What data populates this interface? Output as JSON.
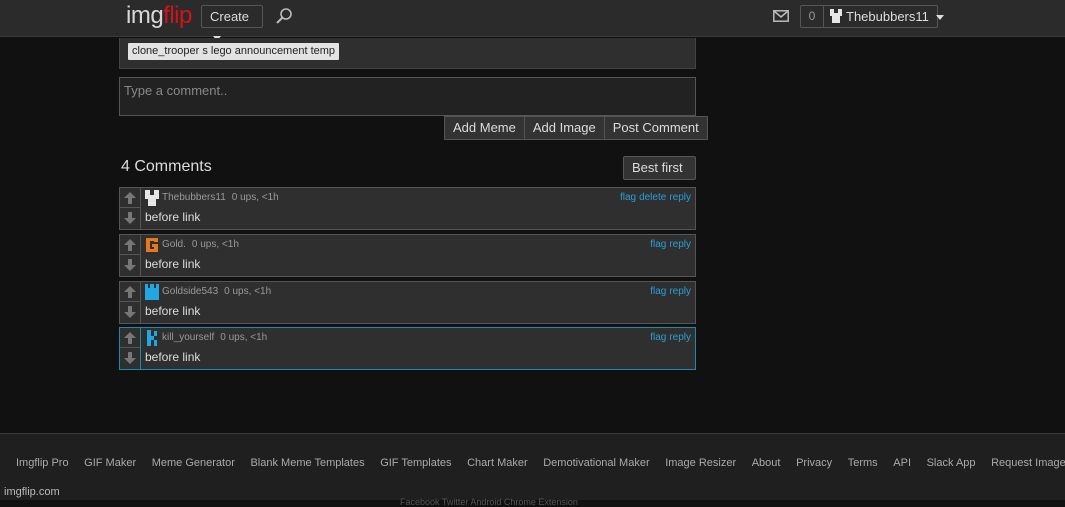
{
  "header": {
    "logo_part1": "img",
    "logo_part2": "flip",
    "create_label": "Create",
    "search_icon": "search-icon",
    "mail_icon": "mail-icon",
    "notification_count": "0",
    "username": "Thebubbers11"
  },
  "tag": {
    "label": "clone_trooper s lego announcement temp"
  },
  "comment_form": {
    "placeholder": "Type a comment..",
    "value": "",
    "buttons": [
      "Add Meme",
      "Add Image",
      "Post Comment"
    ]
  },
  "comments_section": {
    "title": "4 Comments",
    "sort_label": "Best first",
    "comments": [
      {
        "user": "Thebubbers11",
        "meta": "0 ups, <1h",
        "text": "before link",
        "actions": [
          "flag",
          "delete",
          "reply"
        ],
        "avatar_color": "#e6e6e6",
        "highlight": false
      },
      {
        "user": "Gold.",
        "meta": "0 ups, <1h",
        "text": "before link",
        "actions": [
          "flag",
          "reply"
        ],
        "avatar_color": "#e8781e",
        "highlight": false
      },
      {
        "user": "Goldside543",
        "meta": "0 ups, <1h",
        "text": "before link",
        "actions": [
          "flag",
          "reply"
        ],
        "avatar_color": "#22a7e0",
        "highlight": false
      },
      {
        "user": "kill_yourself",
        "meta": "0 ups, <1h",
        "text": "before link",
        "actions": [
          "flag",
          "reply"
        ],
        "avatar_color": "#22a7e0",
        "highlight": true
      }
    ]
  },
  "footer": {
    "links": [
      "Imgflip Pro",
      "GIF Maker",
      "Meme Generator",
      "Blank Meme Templates",
      "GIF Templates",
      "Chart Maker",
      "Demotivational Maker",
      "Image Resizer",
      "About",
      "Privacy",
      "Terms",
      "API",
      "Slack App",
      "Request Image Removal"
    ],
    "site_url": "imgflip.com",
    "faded_text": "Facebook   Twitter   Android   Chrome Extension"
  },
  "colors": {
    "brand_red": "#d0141c",
    "link_blue": "#2a9fd6",
    "highlight_border": "#1a8bb0"
  }
}
